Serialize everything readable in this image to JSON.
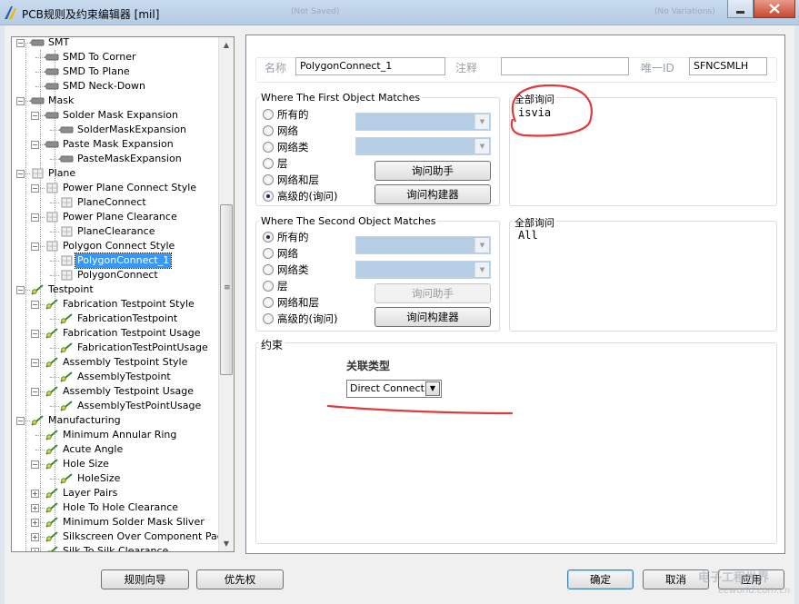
{
  "window": {
    "title": "PCB规则及约束编辑器 [mil]",
    "ghost_a": "(Not Saved)",
    "ghost_b": "(No Variations)"
  },
  "tree": {
    "items": [
      {
        "label": "SMT",
        "level": 1,
        "expander": "−",
        "icon": "smt-icon"
      },
      {
        "label": "SMD To Corner",
        "level": 2,
        "icon": "smd-icon"
      },
      {
        "label": "SMD To Plane",
        "level": 2,
        "icon": "smd-icon"
      },
      {
        "label": "SMD Neck-Down",
        "level": 2,
        "icon": "smd-icon"
      },
      {
        "label": "Mask",
        "level": 1,
        "expander": "−",
        "icon": "mask-icon"
      },
      {
        "label": "Solder Mask Expansion",
        "level": 2,
        "expander": "−",
        "icon": "mask-icon"
      },
      {
        "label": "SolderMaskExpansion",
        "level": 3,
        "icon": "mask-icon"
      },
      {
        "label": "Paste Mask Expansion",
        "level": 2,
        "expander": "−",
        "icon": "mask-icon"
      },
      {
        "label": "PasteMaskExpansion",
        "level": 3,
        "icon": "mask-icon"
      },
      {
        "label": "Plane",
        "level": 1,
        "expander": "−",
        "icon": "plane-icon"
      },
      {
        "label": "Power Plane Connect Style",
        "level": 2,
        "expander": "−",
        "icon": "plane-icon"
      },
      {
        "label": "PlaneConnect",
        "level": 3,
        "icon": "plane-icon"
      },
      {
        "label": "Power Plane Clearance",
        "level": 2,
        "expander": "−",
        "icon": "plane-icon"
      },
      {
        "label": "PlaneClearance",
        "level": 3,
        "icon": "plane-icon"
      },
      {
        "label": "Polygon Connect Style",
        "level": 2,
        "expander": "−",
        "icon": "plane-icon"
      },
      {
        "label": "PolygonConnect_1",
        "level": 3,
        "icon": "plane-icon",
        "selected": true
      },
      {
        "label": "PolygonConnect",
        "level": 3,
        "icon": "plane-icon"
      },
      {
        "label": "Testpoint",
        "level": 1,
        "expander": "−",
        "icon": "testpoint-icon"
      },
      {
        "label": "Fabrication Testpoint Style",
        "level": 2,
        "expander": "−",
        "icon": "testpoint-icon"
      },
      {
        "label": "FabricationTestpoint",
        "level": 3,
        "icon": "testpoint-icon"
      },
      {
        "label": "Fabrication Testpoint Usage",
        "level": 2,
        "expander": "−",
        "icon": "testpoint-icon"
      },
      {
        "label": "FabricationTestPointUsage",
        "level": 3,
        "icon": "testpoint-icon"
      },
      {
        "label": "Assembly Testpoint Style",
        "level": 2,
        "expander": "−",
        "icon": "testpoint-icon"
      },
      {
        "label": "AssemblyTestpoint",
        "level": 3,
        "icon": "testpoint-icon"
      },
      {
        "label": "Assembly Testpoint Usage",
        "level": 2,
        "expander": "−",
        "icon": "testpoint-icon"
      },
      {
        "label": "AssemblyTestPointUsage",
        "level": 3,
        "icon": "testpoint-icon"
      },
      {
        "label": "Manufacturing",
        "level": 1,
        "expander": "−",
        "icon": "manufacturing-icon"
      },
      {
        "label": "Minimum Annular Ring",
        "level": 2,
        "icon": "manufacturing-icon"
      },
      {
        "label": "Acute Angle",
        "level": 2,
        "icon": "manufacturing-icon"
      },
      {
        "label": "Hole Size",
        "level": 2,
        "expander": "−",
        "icon": "manufacturing-icon"
      },
      {
        "label": "HoleSize",
        "level": 3,
        "icon": "manufacturing-icon"
      },
      {
        "label": "Layer Pairs",
        "level": 2,
        "expander": "+",
        "icon": "manufacturing-icon"
      },
      {
        "label": "Hole To Hole Clearance",
        "level": 2,
        "expander": "+",
        "icon": "manufacturing-icon"
      },
      {
        "label": "Minimum Solder Mask Sliver",
        "level": 2,
        "expander": "+",
        "icon": "manufacturing-icon"
      },
      {
        "label": "Silkscreen Over Component Pads",
        "level": 2,
        "expander": "+",
        "icon": "manufacturing-icon"
      },
      {
        "label": "Silk To Silk Clearance",
        "level": 2,
        "expander": "+",
        "icon": "manufacturing-icon"
      }
    ],
    "scroll_grip": "≡"
  },
  "rule": {
    "name_label": "名称",
    "name_value": "PolygonConnect_1",
    "comment_label": "注释",
    "comment_value": "",
    "uid_label": "唯一ID",
    "uid_value": "SFNCSMLH"
  },
  "first_match": {
    "title": "Where The First Object Matches",
    "options": [
      "所有的",
      "网络",
      "网络类",
      "层",
      "网络和层",
      "高级的(询问)"
    ],
    "selected_index": 5,
    "query_helper_label": "询问助手",
    "query_builder_label": "询问构建器",
    "query_title": "全部询问",
    "query_text": "isvia"
  },
  "second_match": {
    "title": "Where The Second Object Matches",
    "options": [
      "所有的",
      "网络",
      "网络类",
      "层",
      "网络和层",
      "高级的(询问)"
    ],
    "selected_index": 0,
    "query_helper_label": "询问助手",
    "query_builder_label": "询问构建器",
    "query_title": "全部询问",
    "query_text": "All"
  },
  "constraints": {
    "title": "约束",
    "connect_type_label": "关联类型",
    "connect_type_value": "Direct Connect"
  },
  "footer": {
    "rule_wizard_label": "规则向导",
    "priority_label": "优先权",
    "ok_label": "确定",
    "cancel_label": "取消",
    "apply_label": "应用",
    "watermark_top": "电子工程世界",
    "watermark_bottom": "eeworld.com.cn"
  },
  "annotation_color": "#e03a3a",
  "selection_color": "#3399ff"
}
